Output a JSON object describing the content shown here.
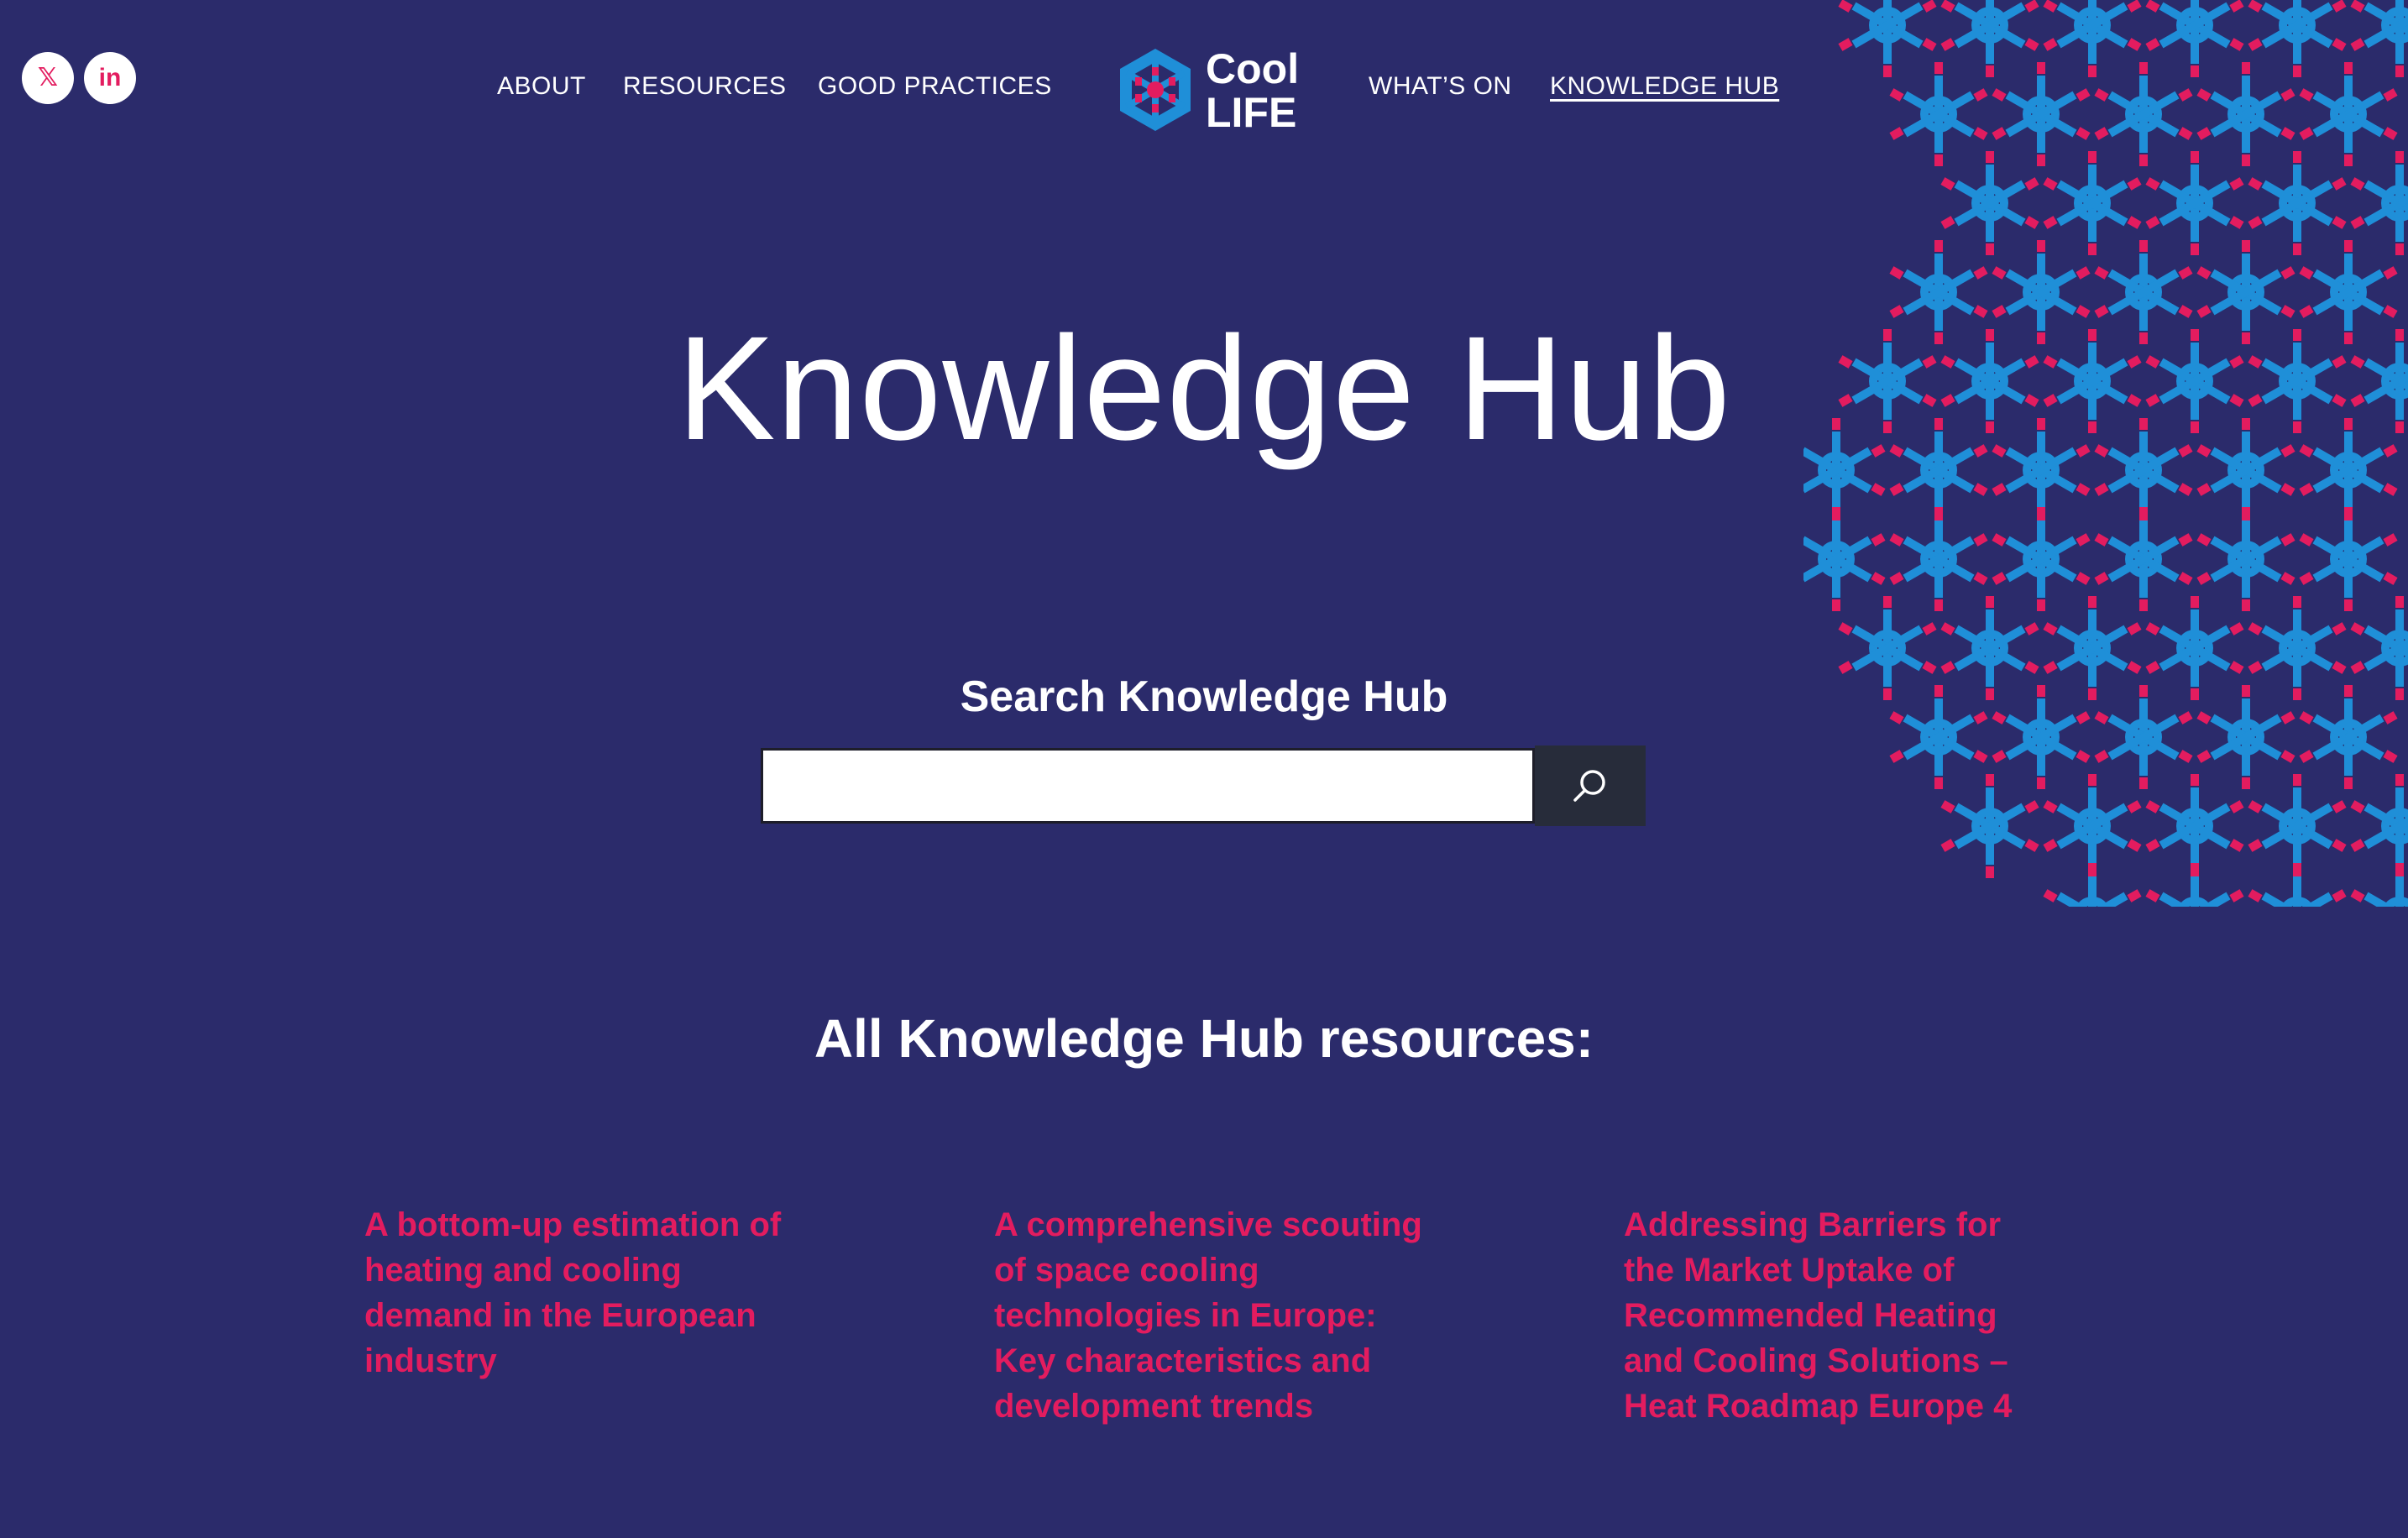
{
  "social": {
    "x_label": "𝕏",
    "linkedin_label": "in"
  },
  "nav": {
    "items_left": [
      "ABOUT",
      "RESOURCES",
      "GOOD PRACTICES"
    ],
    "items_right": [
      "WHAT’S ON",
      "KNOWLEDGE HUB"
    ],
    "active": "KNOWLEDGE HUB"
  },
  "brand": {
    "line1": "Cool",
    "line2": "LIFE"
  },
  "hero": {
    "title": "Knowledge Hub"
  },
  "search": {
    "heading": "Search Knowledge Hub",
    "value": "",
    "placeholder": ""
  },
  "resources": {
    "heading": "All Knowledge Hub resources:",
    "items": [
      "A bottom-up estimation of heating and cooling demand in the European industry",
      "A comprehensive scouting of space cooling technologies in Europe: Key characteristics and development trends",
      "Addressing Barriers for the Market Uptake of Recommended Heating and Cooling Solutions – Heat Roadmap Europe 4"
    ]
  },
  "colors": {
    "background": "#2b2b6b",
    "accent_pink": "#e31c5f",
    "accent_blue": "#1f8fd8",
    "search_button": "#272c3a"
  }
}
